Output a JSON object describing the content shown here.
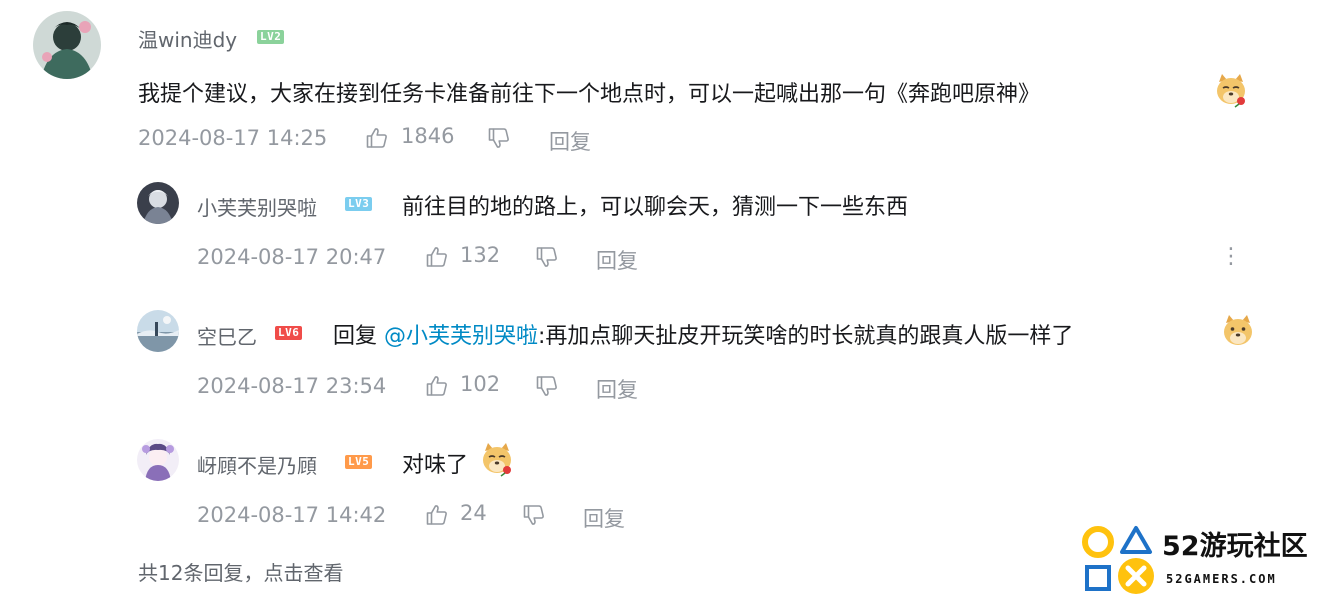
{
  "colors": {
    "lv2": "#8bd29b",
    "lv3": "#7bcdef",
    "lv5": "#ff9a4a",
    "lv6": "#f04c49",
    "mention": "#008ac5",
    "meta": "#9499a0",
    "logo_yellow": "#ffc20e",
    "logo_blue": "#1e72c8"
  },
  "main_comment": {
    "username": "温win迪dy",
    "level": "LV2",
    "content": "我提个建议，大家在接到任务卡准备前往下一个地点时，可以一起喊出那一句《奔跑吧原神》",
    "emoji": "doge-rose-emoji",
    "time": "2024-08-17 14:25",
    "likes": "1846",
    "reply_label": "回复"
  },
  "replies": [
    {
      "username": "小芙芙别哭啦",
      "level": "LV3",
      "content": "前往目的地的路上，可以聊会天，猜测一下一些东西",
      "time": "2024-08-17 20:47",
      "likes": "132",
      "reply_label": "回复",
      "more_icon": "⋮"
    },
    {
      "username": "空巳乙",
      "level": "LV6",
      "prefix": "回复 ",
      "mention": "@小芙芙别哭啦",
      "content": ":再加点聊天扯皮开玩笑啥的时长就真的跟真人版一样了",
      "emoji": "doge-emoji",
      "time": "2024-08-17 23:54",
      "likes": "102",
      "reply_label": "回复"
    },
    {
      "username": "岈頋不是乃頋",
      "level": "LV5",
      "content": "对味了",
      "emoji": "doge-rose-emoji",
      "time": "2024-08-17 14:42",
      "likes": "24",
      "reply_label": "回复"
    }
  ],
  "footer": {
    "view_more": "共12条回复，点击查看"
  },
  "watermark": {
    "name": "52游玩社区",
    "url": "52GAMERS.COM"
  }
}
